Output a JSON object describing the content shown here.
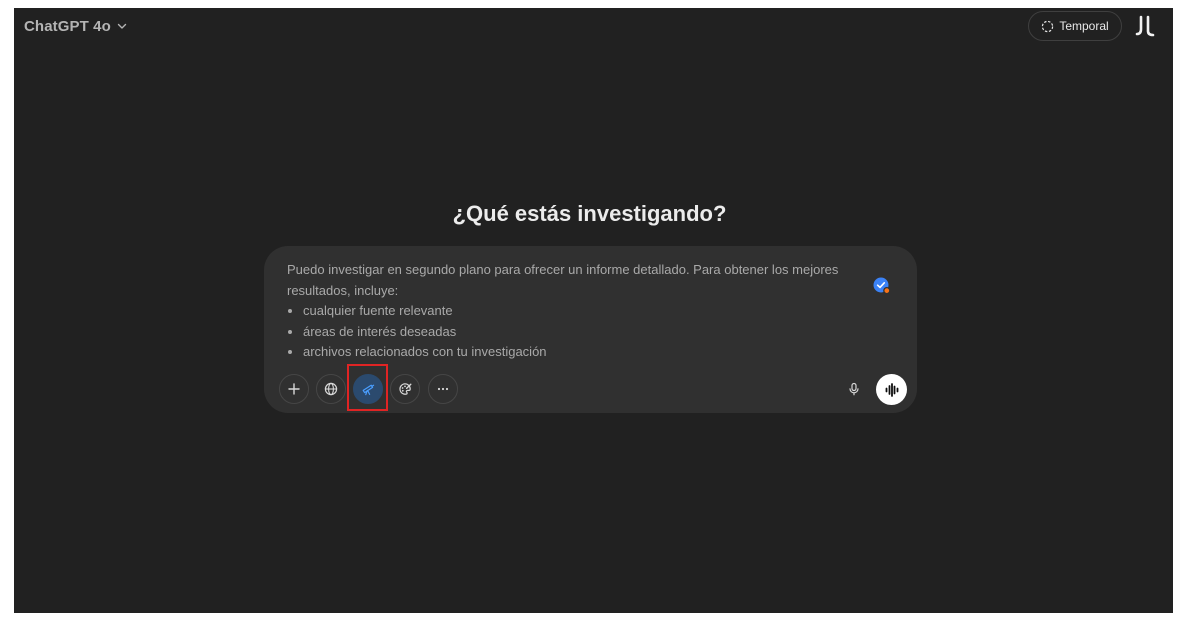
{
  "header": {
    "model_name": "ChatGPT 4o",
    "temporal_label": "Temporal"
  },
  "main": {
    "title": "¿Qué estás investigando?"
  },
  "composer": {
    "placeholder_intro": "Puedo investigar en segundo plano para ofrecer un informe detallado. Para obtener los mejores resultados, incluye:",
    "placeholder_items": [
      "cualquier fuente relevante",
      "áreas de interés deseadas",
      "archivos relacionados con tu investigación"
    ]
  },
  "toolbar": {
    "active_tool": "deep-research-button"
  },
  "icons": {
    "model_chevron": "chevron-down-icon",
    "temporal": "dashed-circle-icon",
    "avatar": "user-avatar-icon",
    "badge": "verified-check-icon",
    "plus": "plus-icon",
    "search": "globe-icon",
    "deep_research": "telescope-icon",
    "canvas": "palette-icon",
    "more": "ellipsis-icon",
    "mic": "microphone-icon",
    "voice": "voice-waveform-icon"
  },
  "colors": {
    "background": "#212121",
    "composer": "#303030",
    "accent_blue": "#4a9eff",
    "active_tool_bg": "#2b4a6e",
    "highlight_red": "#e02424",
    "badge_blue": "#3b82f6",
    "badge_dot": "#f97316"
  }
}
